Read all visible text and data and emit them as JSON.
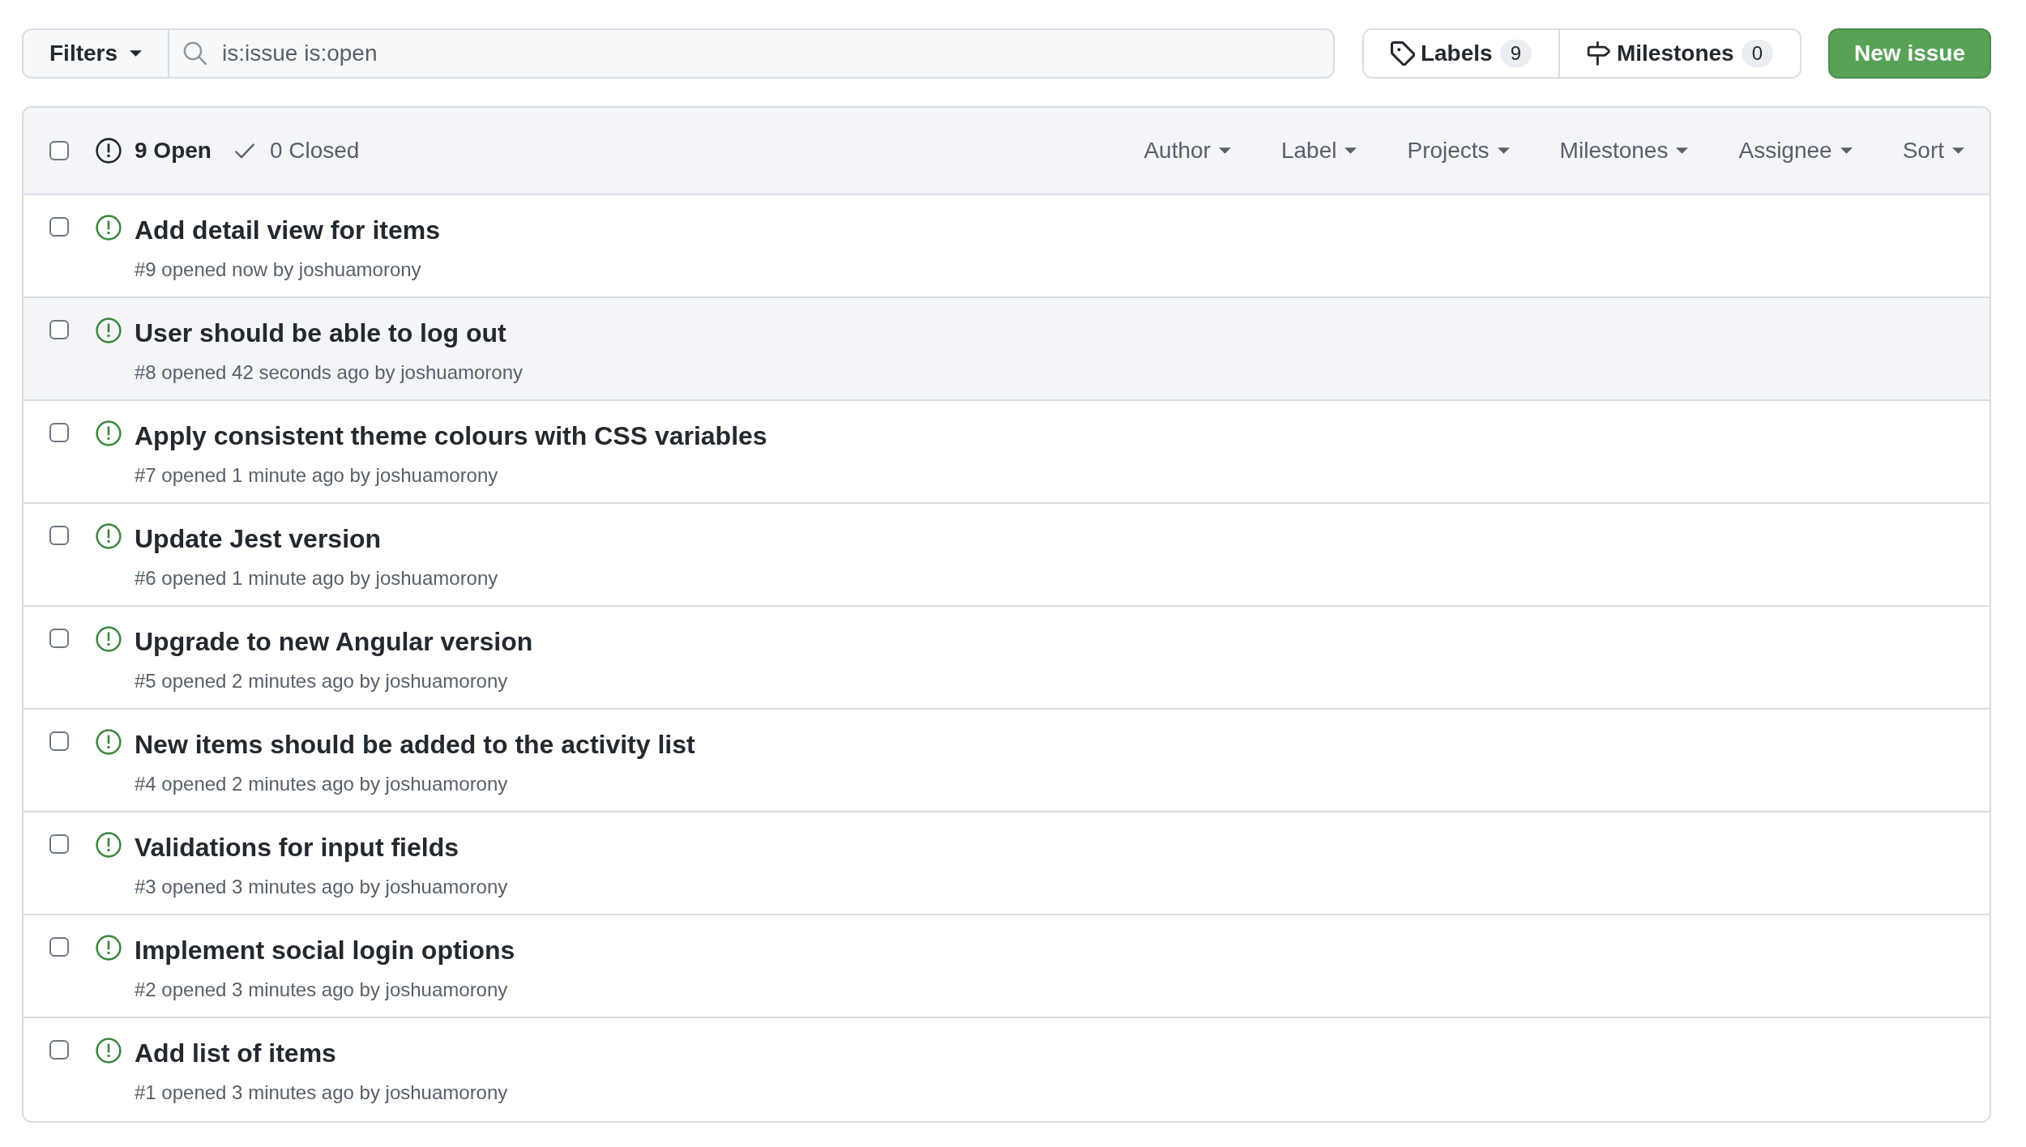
{
  "filters_button": {
    "label": "Filters"
  },
  "search": {
    "value": "is:issue is:open"
  },
  "label_milestone_buttons": [
    {
      "kind": "labels",
      "label": "Labels",
      "count": "9"
    },
    {
      "kind": "milestones",
      "label": "Milestones",
      "count": "0"
    }
  ],
  "new_issue_button": {
    "label": "New issue"
  },
  "issue_list": {
    "select_all_checkbox": {
      "checked": false
    },
    "state_tabs": [
      {
        "kind": "open",
        "label": "9 Open",
        "selected": true
      },
      {
        "kind": "closed",
        "label": "0 Closed",
        "selected": false
      }
    ],
    "filter_menus": [
      "Author",
      "Label",
      "Projects",
      "Milestones",
      "Assignee",
      "Sort"
    ],
    "issues": [
      {
        "title": "Add detail view for items",
        "meta": "#9 opened now by joshuamorony",
        "checked": false,
        "highlighted": false
      },
      {
        "title": "User should be able to log out",
        "meta": "#8 opened 42 seconds ago by joshuamorony",
        "checked": false,
        "highlighted": true
      },
      {
        "title": "Apply consistent theme colours with CSS variables",
        "meta": "#7 opened 1 minute ago by joshuamorony",
        "checked": false,
        "highlighted": false
      },
      {
        "title": "Update Jest version",
        "meta": "#6 opened 1 minute ago by joshuamorony",
        "checked": false,
        "highlighted": false
      },
      {
        "title": "Upgrade to new Angular version",
        "meta": "#5 opened 2 minutes ago by joshuamorony",
        "checked": false,
        "highlighted": false
      },
      {
        "title": "New items should be added to the activity list",
        "meta": "#4 opened 2 minutes ago by joshuamorony",
        "checked": false,
        "highlighted": false
      },
      {
        "title": "Validations for input fields",
        "meta": "#3 opened 3 minutes ago by joshuamorony",
        "checked": false,
        "highlighted": false
      },
      {
        "title": "Implement social login options",
        "meta": "#2 opened 3 minutes ago by joshuamorony",
        "checked": false,
        "highlighted": false
      },
      {
        "title": "Add list of items",
        "meta": "#1 opened 3 minutes ago by joshuamorony",
        "checked": false,
        "highlighted": false
      }
    ]
  }
}
